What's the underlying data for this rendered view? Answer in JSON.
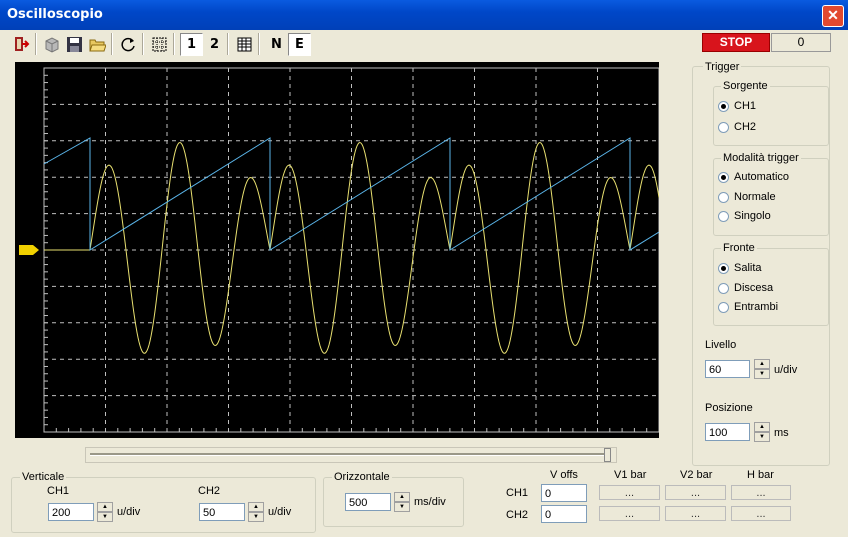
{
  "window": {
    "title": "Oscilloscopio",
    "close_glyph": "✕"
  },
  "toolbar": {
    "icons": [
      "exit-icon",
      "cube-icon",
      "save-icon",
      "open-folder-icon",
      "refresh-icon",
      "grid-select-icon",
      "table-icon"
    ],
    "ch1_label": "1",
    "ch2_label": "2",
    "n_label": "N",
    "e_label": "E",
    "stop_label": "STOP",
    "counter": "0"
  },
  "trigger": {
    "title": "Trigger",
    "sorgente": {
      "title": "Sorgente",
      "options": [
        "CH1",
        "CH2"
      ],
      "selected": 0
    },
    "modalita": {
      "title": "Modalità trigger",
      "options": [
        "Automatico",
        "Normale",
        "Singolo"
      ],
      "selected": 0
    },
    "fronte": {
      "title": "Fronte",
      "options": [
        "Salita",
        "Discesa",
        "Entrambi"
      ],
      "selected": 0
    },
    "livello": {
      "label": "Livello",
      "value": "60",
      "unit": "u/div"
    },
    "posizione": {
      "label": "Posizione",
      "value": "100",
      "unit": "ms"
    }
  },
  "verticale": {
    "title": "Verticale",
    "ch1": {
      "label": "CH1",
      "value": "200",
      "unit": "u/div"
    },
    "ch2": {
      "label": "CH2",
      "value": "50",
      "unit": "u/div"
    }
  },
  "orizzontale": {
    "title": "Orizzontale",
    "value": "500",
    "unit": "ms/div"
  },
  "measure": {
    "headers": [
      "V offs",
      "V1 bar",
      "V2 bar",
      "H bar"
    ],
    "rows": [
      {
        "label": "CH1",
        "voffs": "0",
        "v1": "...",
        "v2": "...",
        "h": "..."
      },
      {
        "label": "CH2",
        "voffs": "0",
        "v1": "...",
        "v2": "...",
        "h": "..."
      }
    ]
  },
  "scope": {
    "background": "#000000",
    "grid_color": "#c0c0c0",
    "ch1_color": "#e8e070",
    "ch2_color": "#5ab4e8",
    "trigger_marker_color": "#f0d000"
  }
}
